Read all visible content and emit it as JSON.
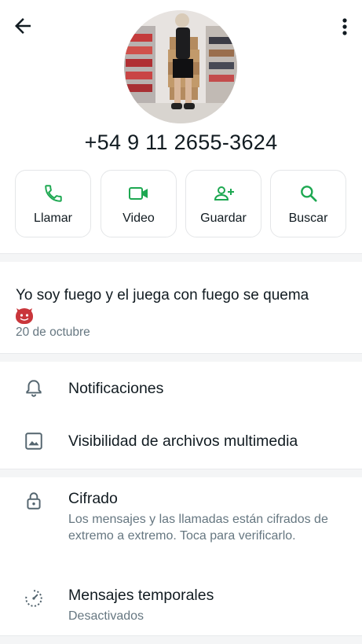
{
  "header": {
    "back_icon": "arrow-left-icon",
    "more_icon": "more-vertical-icon"
  },
  "profile": {
    "phone": "+54 9 11 2655-3624"
  },
  "actions": [
    {
      "label": "Llamar",
      "icon": "phone-icon"
    },
    {
      "label": "Video",
      "icon": "video-camera-icon"
    },
    {
      "label": "Guardar",
      "icon": "add-contact-icon"
    },
    {
      "label": "Buscar",
      "icon": "search-icon"
    }
  ],
  "about": {
    "text": "Yo soy fuego y el juega con fuego se quema",
    "emoji": "devil-emoji-icon",
    "date": "20 de octubre"
  },
  "settings": {
    "notifications": "Notificaciones",
    "media_visibility": "Visibilidad de archivos multimedia"
  },
  "encryption": {
    "title": "Cifrado",
    "description": "Los mensajes y las llamadas están cifrados de extremo a extremo. Toca para verificarlo."
  },
  "disappearing": {
    "title": "Mensajes temporales",
    "status": "Desactivados"
  },
  "colors": {
    "accent": "#1da851",
    "text": "#111b21",
    "secondary": "#667781",
    "divider": "#f4f5f6"
  }
}
